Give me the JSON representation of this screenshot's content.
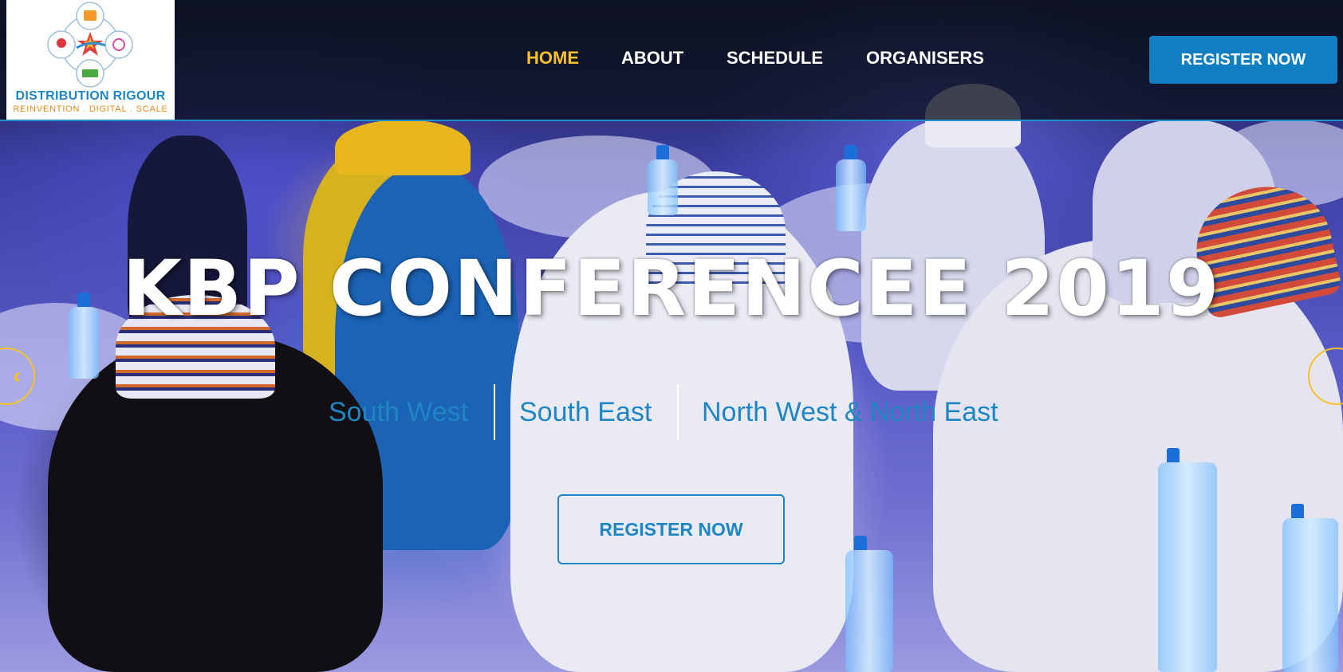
{
  "brand": {
    "name": "DISTRIBUTION RIGOUR",
    "tagline": "REINVENTION . DIGITAL . SCALE"
  },
  "nav": {
    "items": [
      {
        "label": "HOME",
        "active": true
      },
      {
        "label": "ABOUT",
        "active": false
      },
      {
        "label": "SCHEDULE",
        "active": false
      },
      {
        "label": "ORGANISERS",
        "active": false
      }
    ]
  },
  "header": {
    "register_label": "REGISTER NOW"
  },
  "hero": {
    "title": "KBP CONFERENCEE 2019",
    "regions": [
      "South West",
      "South East",
      "North West & North East"
    ],
    "register_label": "REGISTER NOW",
    "prev_icon": "chevron-left-icon",
    "next_icon": "chevron-right-icon"
  },
  "colors": {
    "accent": "#1f86c4",
    "active_nav": "#f6c22b",
    "button_bg": "#0f7fc2"
  }
}
